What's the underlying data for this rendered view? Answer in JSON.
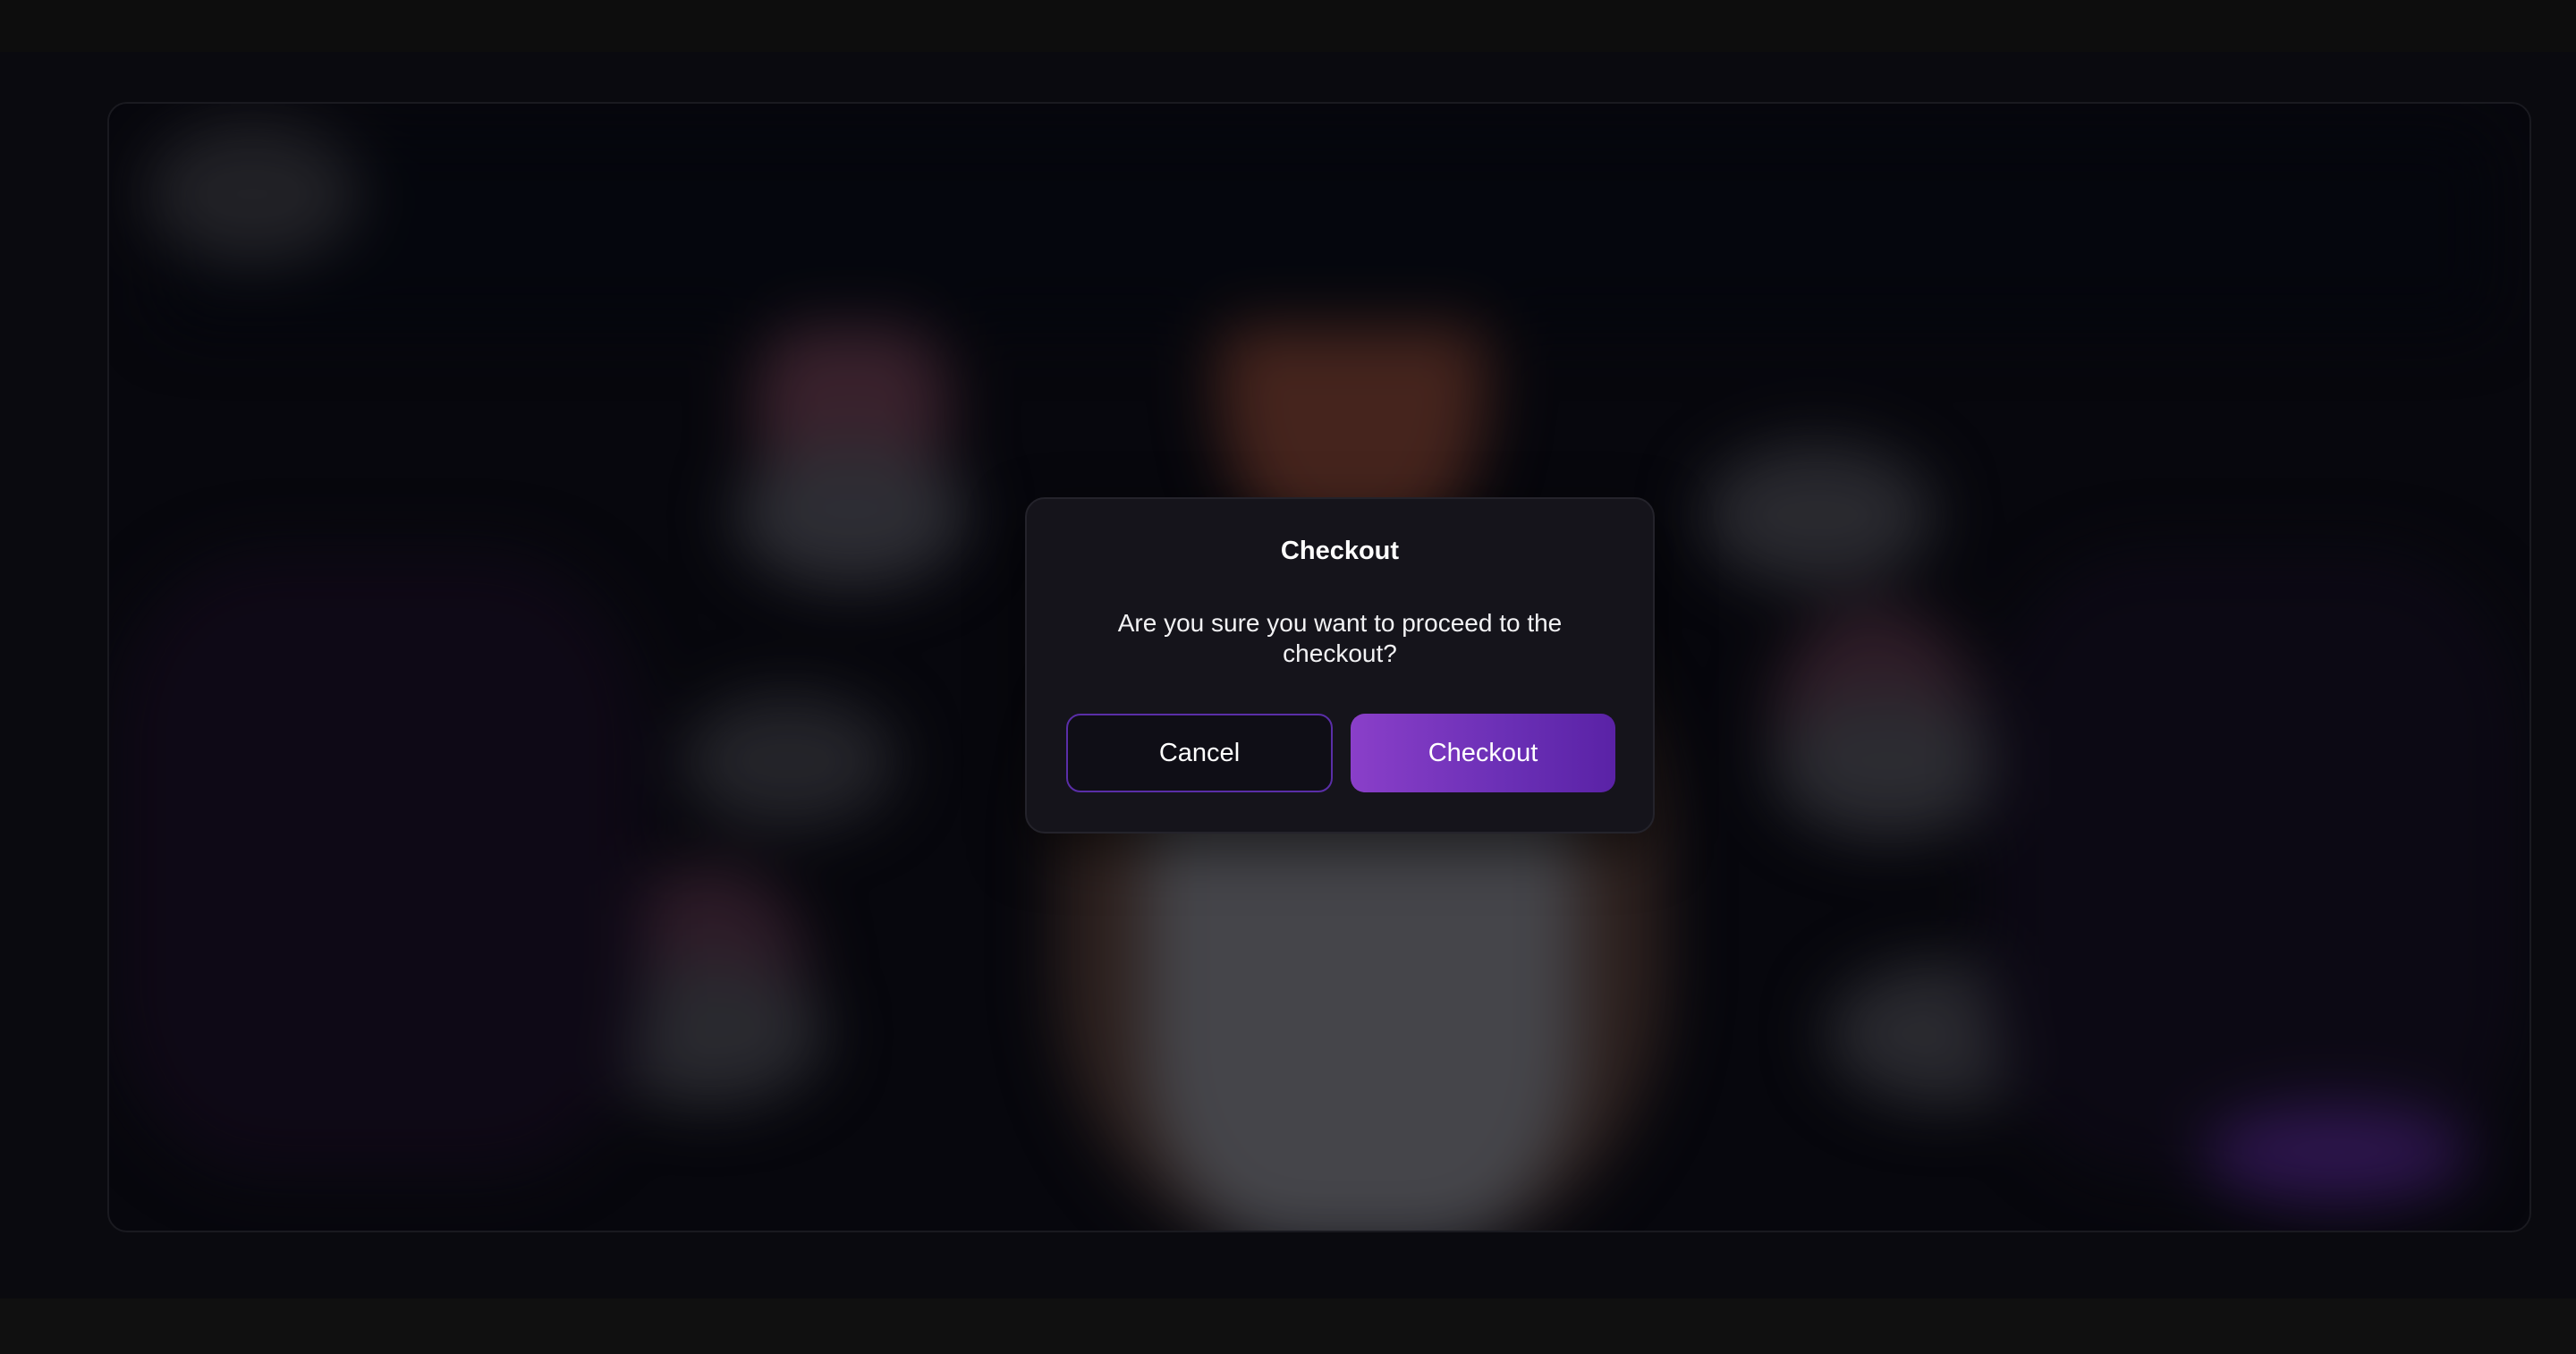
{
  "dialog": {
    "title": "Checkout",
    "message": "Are you sure you want to proceed to the checkout?",
    "cancel_label": "Cancel",
    "confirm_label": "Checkout"
  },
  "colors": {
    "accent": "#7b3cc4",
    "accent_dark": "#5a22a6",
    "dialog_bg": "#15141b",
    "page_bg": "#0a0a0f"
  }
}
